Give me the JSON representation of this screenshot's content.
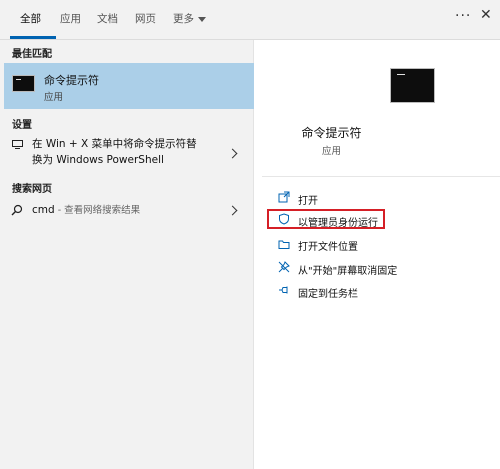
{
  "tabs": [
    {
      "label": "全部",
      "active": true
    },
    {
      "label": "应用"
    },
    {
      "label": "文档"
    },
    {
      "label": "网页"
    },
    {
      "label": "更多"
    }
  ],
  "header_icons": [
    "more-options-icon",
    "close-icon"
  ],
  "left": {
    "sections": {
      "best_match": "最佳匹配",
      "settings": "设置",
      "web": "搜索网页"
    },
    "best_match": {
      "title": "命令提示符",
      "subtitle": "应用",
      "icon": "command-prompt-icon"
    },
    "settings_item": {
      "line1": "在 Win + X 菜单中将命令提示符替",
      "line2": "换为 Windows PowerShell",
      "icon": "monitor-icon"
    },
    "web_item": {
      "query": "cmd",
      "suffix": " - 查看网络搜索结果",
      "icon": "search-icon"
    }
  },
  "right": {
    "app": {
      "title": "命令提示符",
      "subtitle": "应用"
    },
    "actions": [
      {
        "label": "打开",
        "icon": "open-icon"
      },
      {
        "label": "以管理员身份运行",
        "icon": "shield-icon",
        "highlighted": true
      },
      {
        "label": "打开文件位置",
        "icon": "folder-icon"
      },
      {
        "label": "从\"开始\"屏幕取消固定",
        "icon": "unpin-icon"
      },
      {
        "label": "固定到任务栏",
        "icon": "pin-icon"
      }
    ]
  },
  "colors": {
    "accent": "#0063b1",
    "selection": "#abcfe8",
    "highlight_border": "#d51f26"
  }
}
